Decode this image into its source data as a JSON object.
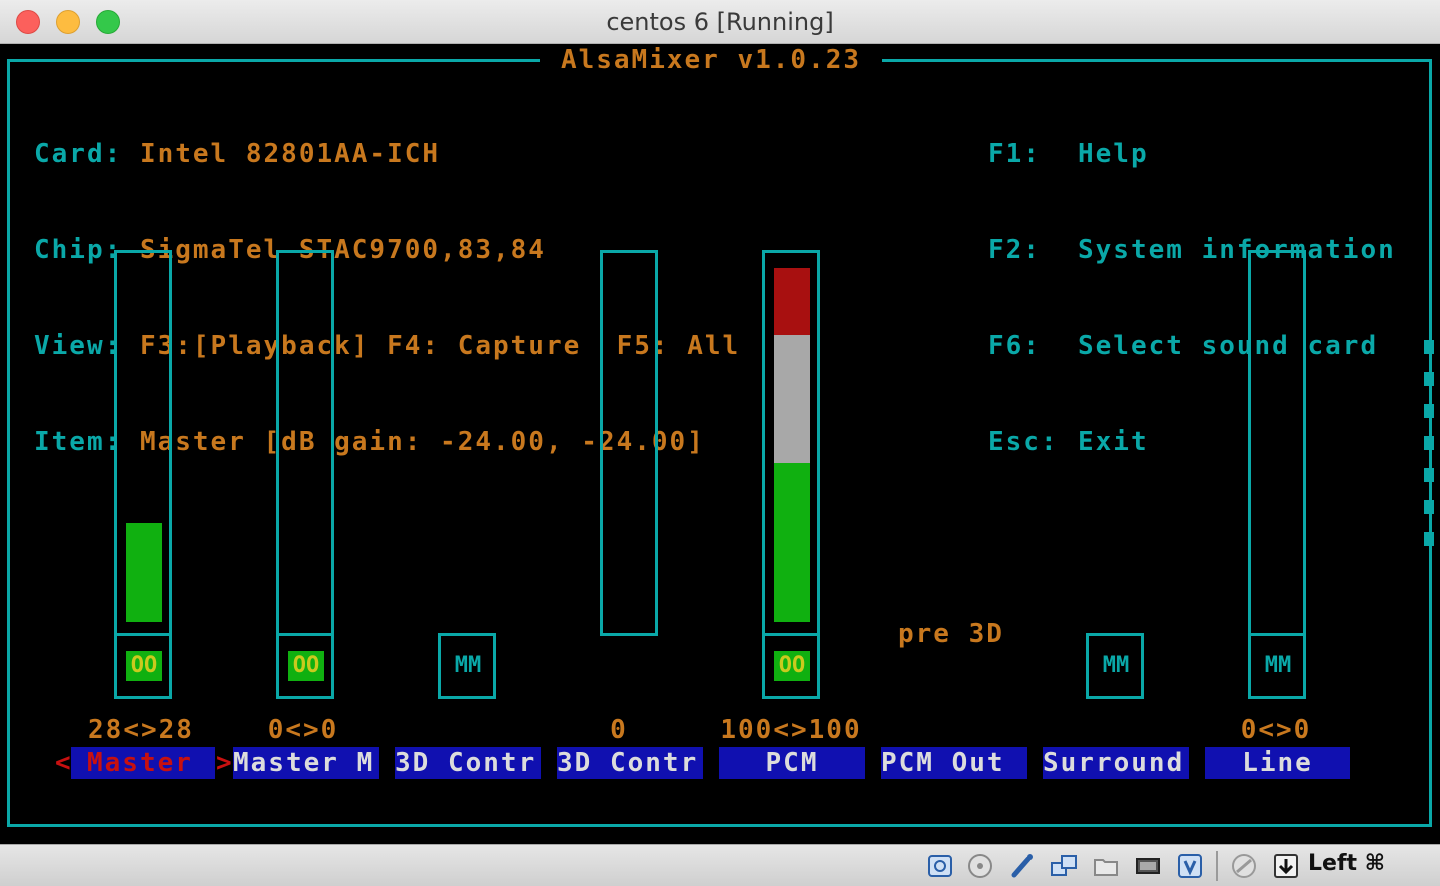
{
  "window": {
    "title": "centos 6 [Running]"
  },
  "mixer": {
    "app_title": "AlsaMixer v1.0.23",
    "info": {
      "card_key": "Card:",
      "card_val": "Intel 82801AA-ICH",
      "chip_key": "Chip:",
      "chip_val": "SigmaTel STAC9700,83,84",
      "view_key": "View:",
      "view_val": "F3:[Playback] F4: Capture  F5: All",
      "item_key": "Item:",
      "item_val": "Master [dB gain: -24.00, -24.00]"
    },
    "keys": [
      {
        "key": "F1:",
        "label": "Help"
      },
      {
        "key": "F2:",
        "label": "System information"
      },
      {
        "key": "F6:",
        "label": "Select sound card"
      },
      {
        "key": "Esc:",
        "label": "Exit"
      }
    ],
    "selected_marker_left": "<",
    "selected_marker_right": ">",
    "pre3d_label": "pre 3D",
    "channels": [
      {
        "name": "Master",
        "volume_label": "28<>28",
        "mute": "OO",
        "level_percent": 28
      },
      {
        "name": "Master M",
        "volume_label": "0<>0",
        "mute": "OO",
        "level_percent": 0
      },
      {
        "name": "3D Contr",
        "volume_label": "",
        "mute": "MM"
      },
      {
        "name": "3D Contr",
        "volume_label": "0",
        "mute": "",
        "level_percent": 0
      },
      {
        "name": "PCM",
        "volume_label": "100<>100",
        "mute": "OO",
        "level_percent": 100
      },
      {
        "name": "PCM Out",
        "volume_label": "",
        "mute": ""
      },
      {
        "name": "Surround",
        "volume_label": "",
        "mute": "MM"
      },
      {
        "name": "Line",
        "volume_label": "0<>0",
        "mute": "MM",
        "level_percent": 0
      }
    ],
    "colors": {
      "border": "#0aa8a8",
      "text_orange": "#c8781e",
      "bar_green": "#10b010",
      "bar_white": "#a8a8a8",
      "bar_red": "#a81010",
      "name_bg": "#1010b0",
      "selected_text": "#c81010"
    }
  },
  "statusbar": {
    "host_key": "Left ⌘",
    "icons": [
      "hard-disk-icon",
      "optical-drive-icon",
      "usb-icon",
      "network-icon",
      "shared-folder-icon",
      "display-icon",
      "virtualbox-icon",
      "mouse-integration-icon",
      "download-icon"
    ]
  }
}
